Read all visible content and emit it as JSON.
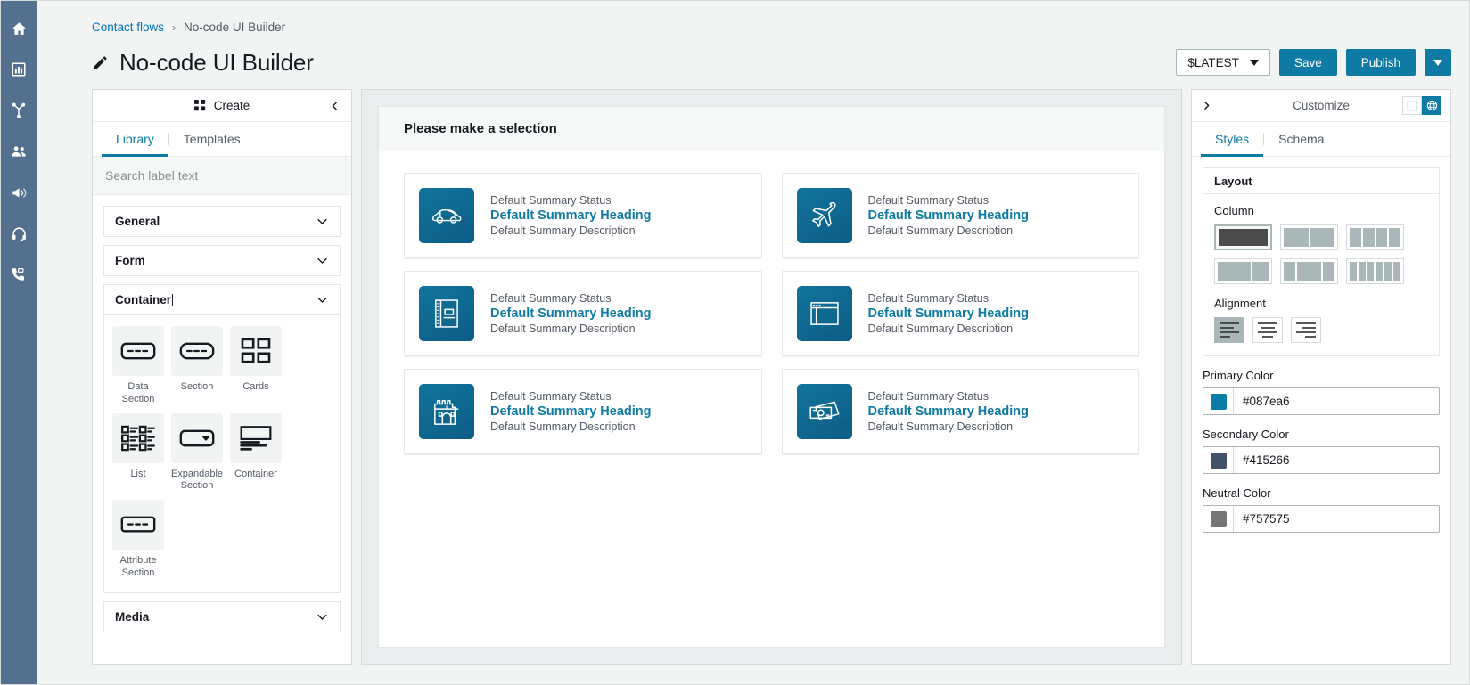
{
  "rail": {
    "items": [
      {
        "name": "home-icon",
        "label": "Home"
      },
      {
        "name": "analytics-icon",
        "label": "Analytics"
      },
      {
        "name": "routing-icon",
        "label": "Routing"
      },
      {
        "name": "users-icon",
        "label": "Users"
      },
      {
        "name": "campaigns-icon",
        "label": "Campaigns"
      },
      {
        "name": "agent-desktop-icon",
        "label": "Agent desktop"
      },
      {
        "name": "phone-icon",
        "label": "Channels"
      }
    ]
  },
  "breadcrumb": {
    "parent": "Contact flows",
    "separator": "›",
    "current": "No-code UI Builder"
  },
  "header": {
    "title": "No-code UI Builder",
    "version_label": "$LATEST",
    "save_label": "Save",
    "publish_label": "Publish"
  },
  "library": {
    "panel_title": "Create",
    "tabs": [
      {
        "label": "Library",
        "active": true
      },
      {
        "label": "Templates",
        "active": false
      }
    ],
    "search_placeholder": "Search label text",
    "sections": [
      {
        "title": "General",
        "expanded": false
      },
      {
        "title": "Form",
        "expanded": false
      },
      {
        "title": "Container",
        "expanded": true
      },
      {
        "title": "Media",
        "expanded": false
      }
    ],
    "container_components": [
      {
        "label": "Data Section",
        "icon": "data-section-icon"
      },
      {
        "label": "Section",
        "icon": "section-icon"
      },
      {
        "label": "Cards",
        "icon": "cards-icon"
      },
      {
        "label": "List",
        "icon": "list-icon"
      },
      {
        "label": "Expandable Section",
        "icon": "expandable-section-icon"
      },
      {
        "label": "Container",
        "icon": "container-icon"
      },
      {
        "label": "Attribute Section",
        "icon": "attribute-section-icon"
      }
    ]
  },
  "canvas": {
    "heading": "Please make a selection",
    "cards": [
      {
        "status": "Default Summary Status",
        "heading": "Default Summary Heading",
        "description": "Default Summary Description",
        "icon": "car-icon"
      },
      {
        "status": "Default Summary Status",
        "heading": "Default Summary Heading",
        "description": "Default Summary Description",
        "icon": "airplane-icon"
      },
      {
        "status": "Default Summary Status",
        "heading": "Default Summary Heading",
        "description": "Default Summary Description",
        "icon": "notebook-icon"
      },
      {
        "status": "Default Summary Status",
        "heading": "Default Summary Heading",
        "description": "Default Summary Description",
        "icon": "window-icon"
      },
      {
        "status": "Default Summary Status",
        "heading": "Default Summary Heading",
        "description": "Default Summary Description",
        "icon": "castle-icon"
      },
      {
        "status": "Default Summary Status",
        "heading": "Default Summary Heading",
        "description": "Default Summary Description",
        "icon": "banknote-icon"
      }
    ]
  },
  "customize": {
    "panel_title": "Customize",
    "tabs": [
      {
        "label": "Styles",
        "active": true
      },
      {
        "label": "Schema",
        "active": false
      }
    ],
    "view_toggle": [
      {
        "name": "canvas-view-icon",
        "active": false
      },
      {
        "name": "globe-view-icon",
        "active": true
      }
    ],
    "layout": {
      "section_title": "Layout",
      "column_label": "Column",
      "column_options": [
        {
          "name": "column-1",
          "segments": [
            1
          ],
          "selected": true
        },
        {
          "name": "column-2",
          "segments": [
            1,
            1
          ],
          "selected": false
        },
        {
          "name": "column-4",
          "segments": [
            1,
            1,
            1,
            1
          ],
          "selected": false
        },
        {
          "name": "column-2-wide-left",
          "segments": [
            2,
            1
          ],
          "selected": false
        },
        {
          "name": "column-3",
          "segments": [
            1,
            2,
            1
          ],
          "selected": false
        },
        {
          "name": "column-6",
          "segments": [
            1,
            1,
            1,
            1,
            1,
            1
          ],
          "selected": false
        }
      ],
      "alignment_label": "Alignment",
      "alignment_options": [
        {
          "name": "align-left",
          "selected": true
        },
        {
          "name": "align-center",
          "selected": false
        },
        {
          "name": "align-right",
          "selected": false
        }
      ]
    },
    "colors": [
      {
        "label": "Primary Color",
        "value": "#087ea6",
        "swatch": "#087ea6"
      },
      {
        "label": "Secondary Color",
        "value": "#415266",
        "swatch": "#415266"
      },
      {
        "label": "Neutral Color",
        "value": "#757575",
        "swatch": "#757575"
      }
    ]
  }
}
